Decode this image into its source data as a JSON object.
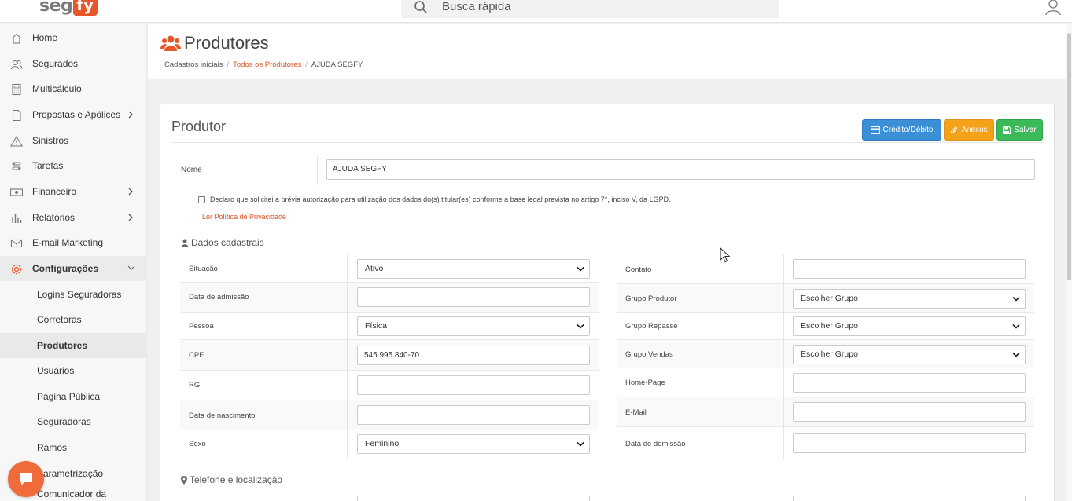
{
  "brand": {
    "logo_seg": "seg",
    "logo_fy": "fy"
  },
  "search": {
    "placeholder": "Busca rápida"
  },
  "colors": {
    "accent": "#e8572a",
    "credit": "#3b8fd6",
    "anexos": "#f5a11a",
    "salvar": "#3cba5a"
  },
  "sidebar": {
    "items": [
      {
        "label": "Home",
        "icon": "home-icon"
      },
      {
        "label": "Segurados",
        "icon": "users-icon"
      },
      {
        "label": "Multicálculo",
        "icon": "calculator-icon"
      },
      {
        "label": "Propostas e Apólices",
        "icon": "document-icon"
      },
      {
        "label": "Sinistros",
        "icon": "warning-icon"
      },
      {
        "label": "Tarefas",
        "icon": "tasks-icon"
      },
      {
        "label": "Financeiro",
        "icon": "money-icon"
      },
      {
        "label": "Relatórios",
        "icon": "bar-chart-icon"
      },
      {
        "label": "E-mail Marketing",
        "icon": "mail-icon"
      },
      {
        "label": "Configurações",
        "icon": "gear-icon"
      }
    ],
    "sub_items": [
      {
        "label": "Logins Seguradoras"
      },
      {
        "label": "Corretoras"
      },
      {
        "label": "Produtores"
      },
      {
        "label": "Usuários"
      },
      {
        "label": "Página Pública"
      },
      {
        "label": "Seguradoras"
      },
      {
        "label": "Ramos"
      },
      {
        "label": "Parametrização"
      },
      {
        "label": "Comunicador da Corretora"
      }
    ]
  },
  "header": {
    "title": "Produtores",
    "breadcrumb": [
      "Cadastros iniciais",
      "Todos os Produtores",
      "AJUDA SEGFY"
    ]
  },
  "card": {
    "title": "Produtor",
    "buttons": {
      "credit": "Crédito/Débito",
      "anexos": "Anexos",
      "salvar": "Salvar"
    },
    "nome_label": "Nome",
    "nome_value": "AJUDA SEGFY",
    "lgpd_text": "Declaro que solicitei a prévia autorização para utilização dos dados do(s) titular(es) conforme a base legal prevista no artigo 7°, inciso V, da LGPD.",
    "policy_link": "Ler Política de Privacidade",
    "section_dados": "Dados cadastrais",
    "section_telefone": "Telefone e localização"
  },
  "left_form": [
    {
      "label": "Situação",
      "value": "Ativo",
      "kind": "select"
    },
    {
      "label": "Data de admissão",
      "value": "",
      "kind": "input"
    },
    {
      "label": "Pessoa",
      "value": "Física",
      "kind": "select"
    },
    {
      "label": "CPF",
      "value": "545.995.840-70",
      "kind": "input"
    },
    {
      "label": "RG",
      "value": "",
      "kind": "input"
    },
    {
      "label": "Data de nascimento",
      "value": "",
      "kind": "input"
    },
    {
      "label": "Sexo",
      "value": "Feminino",
      "kind": "select"
    }
  ],
  "right_form": [
    {
      "label": "Contato",
      "value": "",
      "kind": "input"
    },
    {
      "label": "Grupo Produtor",
      "value": "Escolher Grupo",
      "kind": "select"
    },
    {
      "label": "Grupo Repasse",
      "value": "Escolher Grupo",
      "kind": "select"
    },
    {
      "label": "Grupo Vendas",
      "value": "Escolher Grupo",
      "kind": "select"
    },
    {
      "label": "Home-Page",
      "value": "",
      "kind": "input"
    },
    {
      "label": "E-Mail",
      "value": "",
      "kind": "input"
    },
    {
      "label": "Data de demissão",
      "value": "",
      "kind": "input"
    }
  ]
}
